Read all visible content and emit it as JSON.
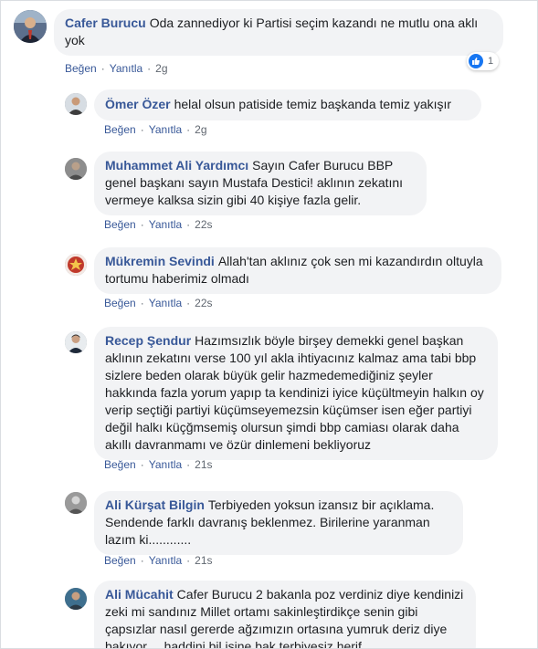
{
  "comments": [
    {
      "author": "Cafer Burucu",
      "text": "Oda zannediyor ki Partisi seçim kazandı ne mutlu ona aklı yok",
      "like_label": "Beğen",
      "reply_label": "Yanıtla",
      "time": "2g",
      "reaction_count": "1"
    },
    {
      "author": "Ömer Özer",
      "text": "helal olsun patiside temiz başkanda temiz yakışır",
      "like_label": "Beğen",
      "reply_label": "Yanıtla",
      "time": "2g"
    },
    {
      "author": "Muhammet Ali Yardımcı",
      "text": "Sayın Cafer Burucu BBP genel başkanı sayın Mustafa Destici! aklının zekatını vermeye kalksa sizin gibi 40 kişiye fazla gelir.",
      "like_label": "Beğen",
      "reply_label": "Yanıtla",
      "time": "22s"
    },
    {
      "author": "Mükremin Sevindi",
      "text": "Allah'tan aklınız çok sen mi kazandırdın oltuyla tortumu haberimiz olmadı",
      "like_label": "Beğen",
      "reply_label": "Yanıtla",
      "time": "22s"
    },
    {
      "author": "Recep Şendur",
      "text": "Hazımsızlık böyle birşey demekki genel başkan aklının zekatını verse 100 yıl akla ihtiyacınız kalmaz ama tabi bbp sizlere beden olarak büyük gelir hazmedemediğiniz şeyler hakkında fazla yorum yapıp ta kendinizi iyice küçültmeyin halkın oy verip seçtiği partiyi küçümseyemezsin küçümser isen eğer partiyi değil halkı küçğmsemiş olursun şimdi bbp camiası olarak daha akıllı davranmamı ve özür dinlemeni bekliyoruz",
      "like_label": "Beğen",
      "reply_label": "Yanıtla",
      "time": "21s"
    },
    {
      "author": "Ali Kürşat Bilgin",
      "text": "Terbiyeden yoksun izansız bir açıklama. Sendende farklı davranış beklenmez. Birilerine yaranman lazım ki............",
      "like_label": "Beğen",
      "reply_label": "Yanıtla",
      "time": "21s"
    },
    {
      "author": "Ali Mücahit",
      "text": "Cafer Burucu 2 bakanla poz verdiniz diye kendinizi zeki mi sandınız Millet ortamı sakinleştirdikçe senin gibi çapsızlar nasıl gererde ağzımızın ortasına yumruk deriz diye bakıyor.....haddini bil işine bak terbiyesiz herif"
    }
  ],
  "colors": {
    "author": "#385898",
    "bubble": "#f2f3f5",
    "meta": "#606770",
    "like_blue": "#1877f2"
  },
  "icons": {
    "reaction": "like-thumb-icon"
  }
}
